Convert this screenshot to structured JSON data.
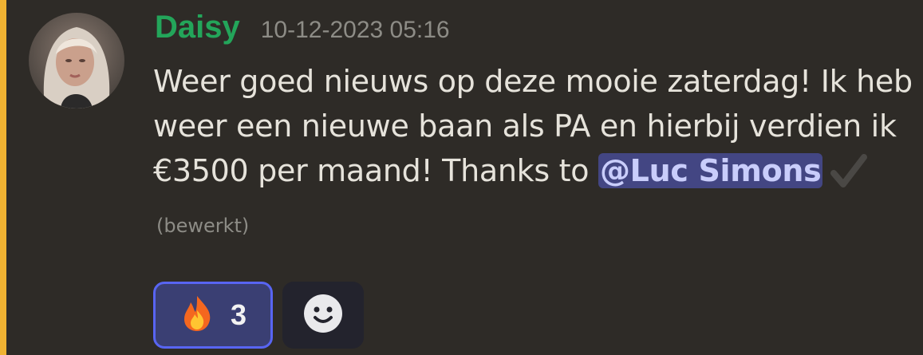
{
  "message": {
    "author": "Daisy",
    "timestamp": "10-12-2023 05:16",
    "text": "Weer goed nieuws op deze mooie zaterdag! Ik heb weer een nieuwe baan als PA en hierbij verdien ik €3500 per maand! Thanks to ",
    "mention": "@Luc Simons",
    "edited_label": "(bewerkt)",
    "reactions": [
      {
        "emoji": "fire",
        "count": "3"
      }
    ],
    "add_reaction_icon": "smiley-icon"
  },
  "colors": {
    "background": "#2e2b27",
    "accent_bar": "#f0b232",
    "username": "#23a55a",
    "mention_bg": "#434683",
    "reaction_border": "#5865f2"
  }
}
